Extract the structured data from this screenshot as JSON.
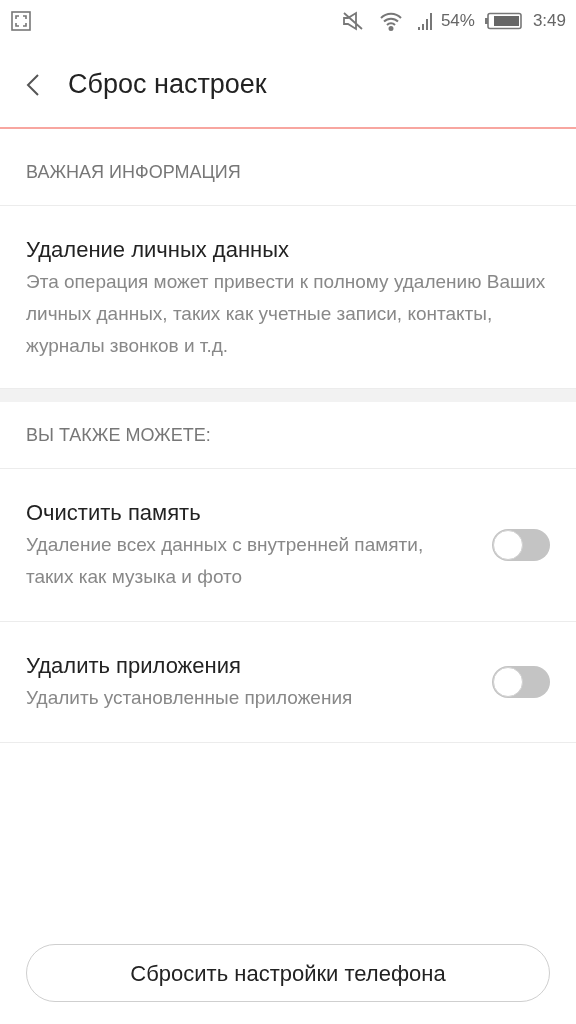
{
  "status_bar": {
    "battery_text": "54%",
    "time": "3:49"
  },
  "header": {
    "title": "Сброс настроек"
  },
  "sections": [
    {
      "heading": "ВАЖНАЯ ИНФОРМАЦИЯ",
      "items": [
        {
          "kind": "info",
          "title": "Удаление личных данных",
          "description": "Эта операция может привести к полному удалению Ваших личных данных, таких как учетные записи, контакты, журналы звонков и т.д."
        }
      ]
    },
    {
      "heading": "ВЫ ТАКЖЕ МОЖЕТЕ:",
      "items": [
        {
          "kind": "toggle",
          "title": "Очистить память",
          "description": "Удаление всех данных с внутренней памяти, таких как музыка и фото",
          "on": false
        },
        {
          "kind": "toggle",
          "title": "Удалить приложения",
          "description": "Удалить установленные приложения",
          "on": false
        }
      ]
    }
  ],
  "button": {
    "label": "Сбросить настройки телефона"
  }
}
